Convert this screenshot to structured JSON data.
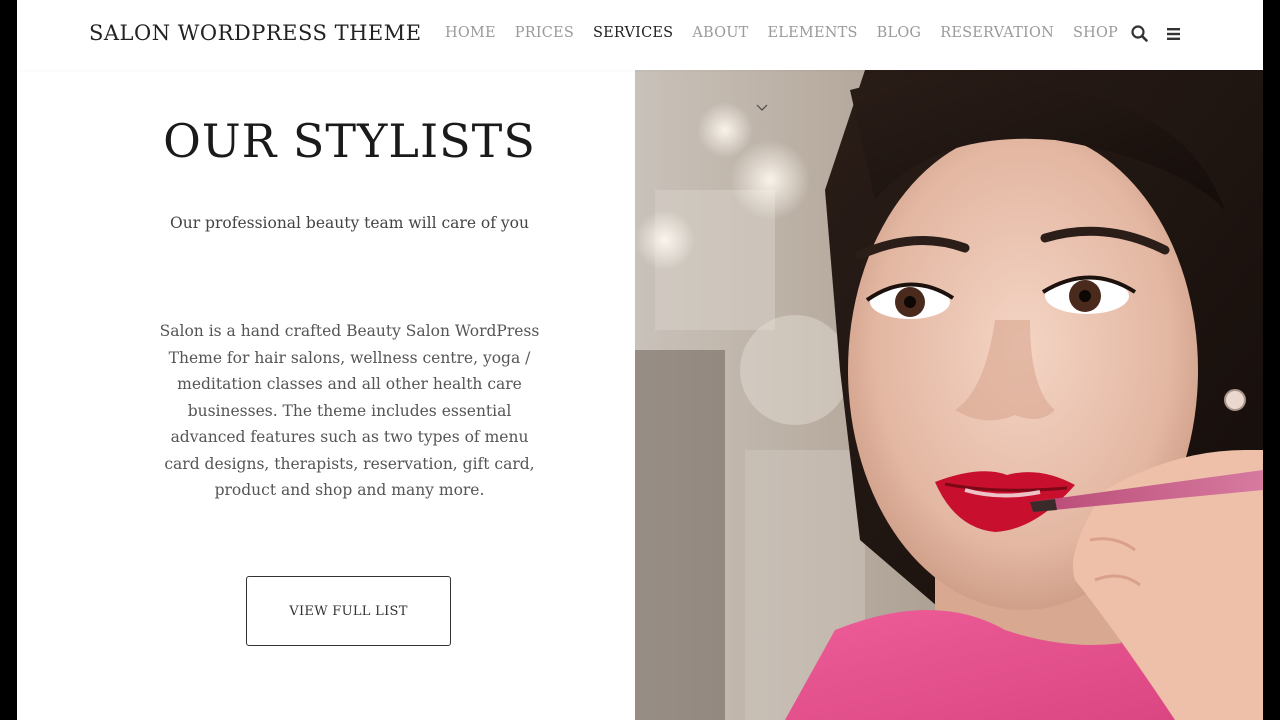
{
  "header": {
    "brand": "SALON WORDPRESS THEME",
    "nav": [
      {
        "label": "HOME",
        "active": false
      },
      {
        "label": "PRICES",
        "active": false
      },
      {
        "label": "SERVICES",
        "active": true
      },
      {
        "label": "ABOUT",
        "active": false
      },
      {
        "label": "ELEMENTS",
        "active": false
      },
      {
        "label": "BLOG",
        "active": false
      },
      {
        "label": "RESERVATION",
        "active": false
      },
      {
        "label": "SHOP",
        "active": false
      }
    ],
    "icons": {
      "search": "search-icon",
      "menu": "hamburger-menu-icon"
    }
  },
  "section": {
    "title": "OUR STYLISTS",
    "subtitle": "Our professional beauty team will care of you",
    "description": "Salon is a hand crafted Beauty Salon WordPress Theme for hair salons, wellness centre, yoga / meditation classes and all other health care businesses. The theme includes essential advanced features such as two types of menu card designs, therapists, reservation, gift card, product and shop and many more.",
    "cta_label": "VIEW FULL LIST"
  },
  "hero_image": {
    "icon": "woman-applying-lipstick-photo",
    "scroll_icon": "chevron-down-icon"
  },
  "colors": {
    "background": "#ffffff",
    "text_dark": "#1a1a1a",
    "nav_inactive": "#9a9a9a",
    "outer_frame": "#000000"
  }
}
